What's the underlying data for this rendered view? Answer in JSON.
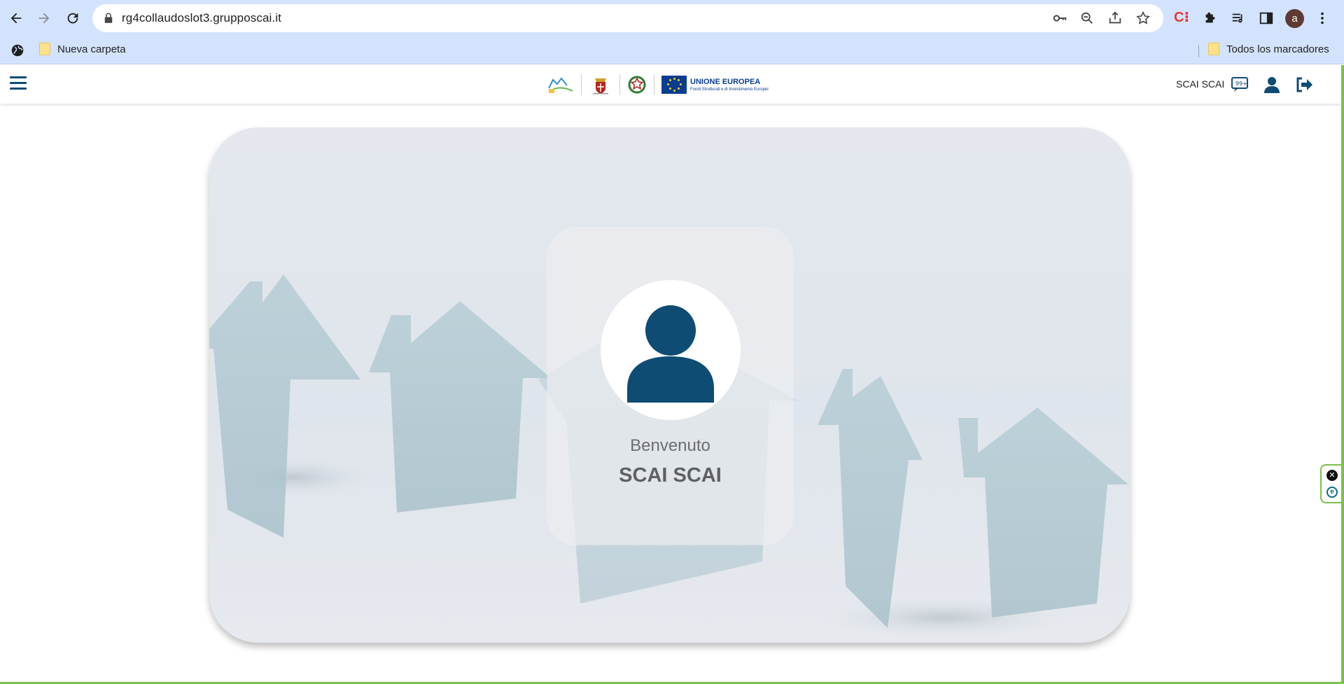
{
  "browser": {
    "url": "rg4collaudoslot3.grupposcai.it",
    "profile_initial": "a",
    "bookmarks": {
      "left_folder": "Nueva carpeta",
      "right_folder": "Todos los marcadores"
    }
  },
  "header": {
    "user_name": "SCAI SCAI",
    "eu_logo_title": "UNIONE EUROPEA",
    "eu_logo_subtitle": "Fondi Strutturali e di Investimento Europei"
  },
  "welcome": {
    "greeting": "Benvenuto",
    "name": "SCAI SCAI"
  },
  "colors": {
    "brand": "#0e4c74",
    "chrome": "#d3e3fd",
    "accent_green": "#7cc04b"
  }
}
